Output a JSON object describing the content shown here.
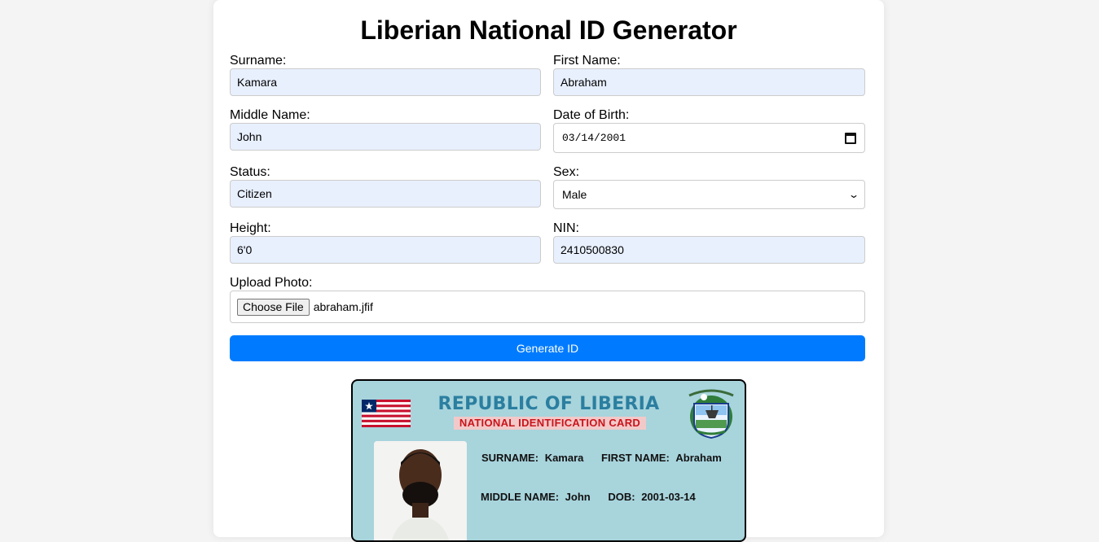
{
  "page": {
    "title": "Liberian National ID Generator"
  },
  "form": {
    "surname": {
      "label": "Surname:",
      "value": "Kamara"
    },
    "first_name": {
      "label": "First Name:",
      "value": "Abraham"
    },
    "middle_name": {
      "label": "Middle Name:",
      "value": "John"
    },
    "dob": {
      "label": "Date of Birth:",
      "value": "03/14/2001"
    },
    "status": {
      "label": "Status:",
      "value": "Citizen"
    },
    "sex": {
      "label": "Sex:",
      "value": "Male"
    },
    "height": {
      "label": "Height:",
      "value": "6'0"
    },
    "nin": {
      "label": "NIN:",
      "value": "2410500830"
    },
    "photo": {
      "label": "Upload Photo:",
      "button": "Choose File",
      "filename": "abraham.jfif"
    },
    "generate_label": "Generate ID"
  },
  "card": {
    "title": "REPUBLIC OF LIBERIA",
    "subtitle": "NATIONAL IDENTIFICATION CARD",
    "surname_label": "SURNAME:",
    "surname_value": "Kamara",
    "first_name_label": "FIRST NAME:",
    "first_name_value": "Abraham",
    "middle_name_label": "MIDDLE NAME:",
    "middle_name_value": "John",
    "dob_label": "DOB:",
    "dob_value": "2001-03-14"
  },
  "colors": {
    "page_bg": "#f4f4f4",
    "autofill_bg": "#e8f0fe",
    "primary_button": "#007bff",
    "card_bg": "#a8d4dc",
    "card_title": "#2b7fa0",
    "card_subtitle": "#c9141b"
  },
  "icons": [
    "calendar-icon",
    "chevron-down-icon",
    "liberia-flag-icon",
    "coat-of-arms-icon"
  ]
}
